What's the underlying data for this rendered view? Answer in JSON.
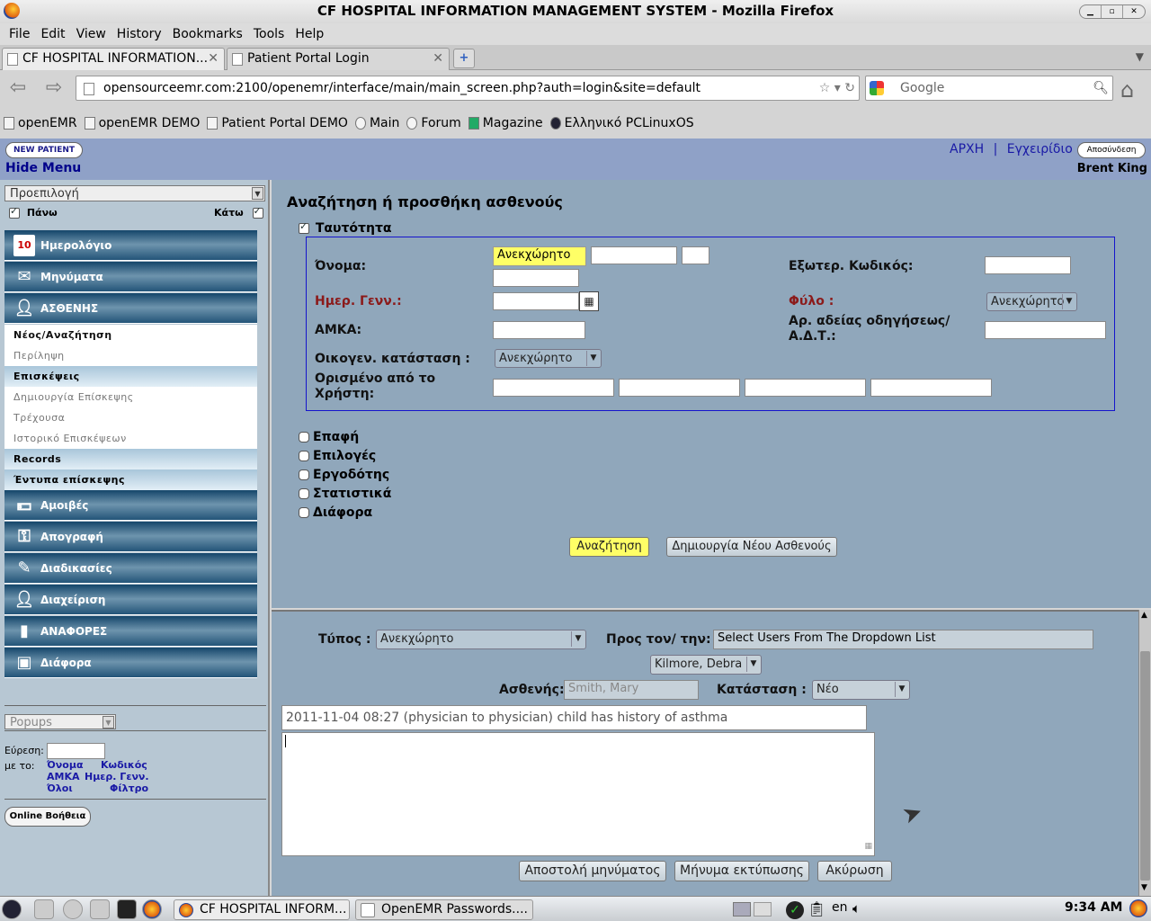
{
  "window": {
    "title": "CF HOSPITAL INFORMATION MANAGEMENT SYSTEM - Mozilla Firefox"
  },
  "menubar": [
    "File",
    "Edit",
    "View",
    "History",
    "Bookmarks",
    "Tools",
    "Help"
  ],
  "tabs": [
    {
      "label": "CF HOSPITAL INFORMATION...",
      "active": true
    },
    {
      "label": "Patient Portal Login",
      "active": false
    }
  ],
  "nav": {
    "url": "opensourceemr.com:2100/openemr/interface/main/main_screen.php?auth=login&site=default",
    "search_placeholder": "Google"
  },
  "bookmarks": [
    "openEMR",
    "openEMR DEMO",
    "Patient Portal DEMO",
    "Main",
    "Forum",
    "Magazine",
    "Ελληνικό PCLinuxOS"
  ],
  "header": {
    "new_patient": "NEW PATIENT",
    "hide_menu": "Hide Menu",
    "link_home": "ΑΡΧΗ",
    "link_sep": "|",
    "link_manual": "Εγχειρίδιο",
    "logout": "Αποσύνδεση",
    "user": "Brent King"
  },
  "sidebar": {
    "preset": "Προεπιλογή",
    "top_label": "Πάνω",
    "bottom_label": "Κάτω",
    "nav": {
      "calendar": "Ημερολόγιο",
      "messages": "Μηνύματα",
      "patient": "ΑΣΘΕΝΗΣ",
      "new_search": "Νέος/Αναζήτηση",
      "summary": "Περίληψη",
      "visits": "Επισκέψεις",
      "create_visit": "Δημιουργία Επίσκεψης",
      "current": "Τρέχουσα",
      "visit_history": "Ιστορικό Επισκέψεων",
      "records": "Records",
      "visit_forms": "Έντυπα επίσκεψης",
      "fees": "Αμοιβές",
      "inventory": "Απογραφή",
      "procedures": "Διαδικασίες",
      "administration": "Διαχείριση",
      "reports": "ΑΝΑΦΟΡΕΣ",
      "misc": "Διάφορα"
    },
    "popups": "Popups",
    "find_label": "Εύρεση:",
    "by_label": "με το:",
    "find_links": {
      "name": "Όνομα",
      "code": "Κωδικός",
      "amka": "ΑΜΚΑ",
      "dob": "Ημερ. Γενν.",
      "all": "Όλοι",
      "filter": "Φίλτρο"
    },
    "online_help": "Online Βοήθεια"
  },
  "search_form": {
    "title": "Αναζήτηση ή προσθήκη ασθενούς",
    "identity": "Ταυτότητα",
    "name_label": "Όνομα:",
    "name_value": "Ανεκχώρητο",
    "ext_code_label": "Εξωτερ. Κωδικός:",
    "dob_label": "Ημερ. Γενν.:",
    "sex_label": "Φύλο :",
    "sex_value": "Ανεκχώρητο",
    "amka_label": "ΑΜΚΑ:",
    "license_label": "Αρ. αδείας οδηγήσεως/ Α.Δ.Τ.:",
    "marital_label": "Οικογεν. κατάσταση :",
    "marital_value": "Ανεκχώρητο",
    "user_defined_label": "Ορισμένο από το Χρήστη:",
    "sections": [
      "Επαφή",
      "Επιλογές",
      "Εργοδότης",
      "Στατιστικά",
      "Διάφορα"
    ],
    "search_btn": "Αναζήτηση",
    "create_btn": "Δημιουργία Νέου Ασθενούς"
  },
  "message": {
    "type_label": "Τύπος :",
    "type_value": "Ανεκχώρητο",
    "to_label": "Προς τον/ την:",
    "to_value": "Select Users From The Dropdown List",
    "user_select": "Kilmore, Debra",
    "patient_label": "Ασθενής:",
    "patient_value": "Smith, Mary",
    "status_label": "Κατάσταση :",
    "status_value": "Νέο",
    "history_line": "2011-11-04 08:27 (physician to physician) child has history of asthma",
    "send_btn": "Αποστολή μηνύματος",
    "print_btn": "Μήνυμα εκτύπωσης",
    "cancel_btn": "Ακύρωση"
  },
  "taskbar": {
    "task1": "CF HOSPITAL INFORM...",
    "task2": "OpenEMR Passwords....",
    "lang": "en",
    "clock": "9:34 AM"
  }
}
